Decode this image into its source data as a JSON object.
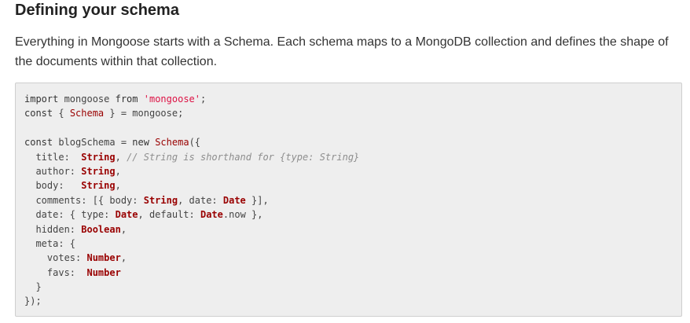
{
  "heading": "Defining your schema",
  "intro": "Everything in Mongoose starts with a Schema. Each schema maps to a MongoDB collection and defines the shape of the documents within that collection.",
  "code": {
    "l1": {
      "kw": "import",
      "mid": " mongoose ",
      "from": "from",
      "sp": " ",
      "str": "'mongoose'",
      "end": ";"
    },
    "l2": {
      "kw": "const",
      "a": " { ",
      "cls": "Schema",
      "b": " } = mongoose;"
    },
    "l4": {
      "kw": "const",
      "a": " blogSchema = ",
      "new": "new",
      "sp": " ",
      "cls": "Schema",
      "b": "({"
    },
    "l5": {
      "a": "  title:  ",
      "t": "String",
      "b": ", ",
      "cm": "// String is shorthand for {type: String}"
    },
    "l6": {
      "a": "  author: ",
      "t": "String",
      "b": ","
    },
    "l7": {
      "a": "  body:   ",
      "t": "String",
      "b": ","
    },
    "l8": {
      "a": "  comments: [{ body: ",
      "t1": "String",
      "b": ", date: ",
      "t2": "Date",
      "c": " }],"
    },
    "l9": {
      "a": "  date: { type: ",
      "t1": "Date",
      "b": ", default: ",
      "t2": "Date",
      "c": ".now },"
    },
    "l10": {
      "a": "  hidden: ",
      "t": "Boolean",
      "b": ","
    },
    "l11": {
      "a": "  meta: {"
    },
    "l12": {
      "a": "    votes: ",
      "t": "Number",
      "b": ","
    },
    "l13": {
      "a": "    favs:  ",
      "t": "Number"
    },
    "l14": {
      "a": "  }"
    },
    "l15": {
      "a": "});"
    }
  }
}
